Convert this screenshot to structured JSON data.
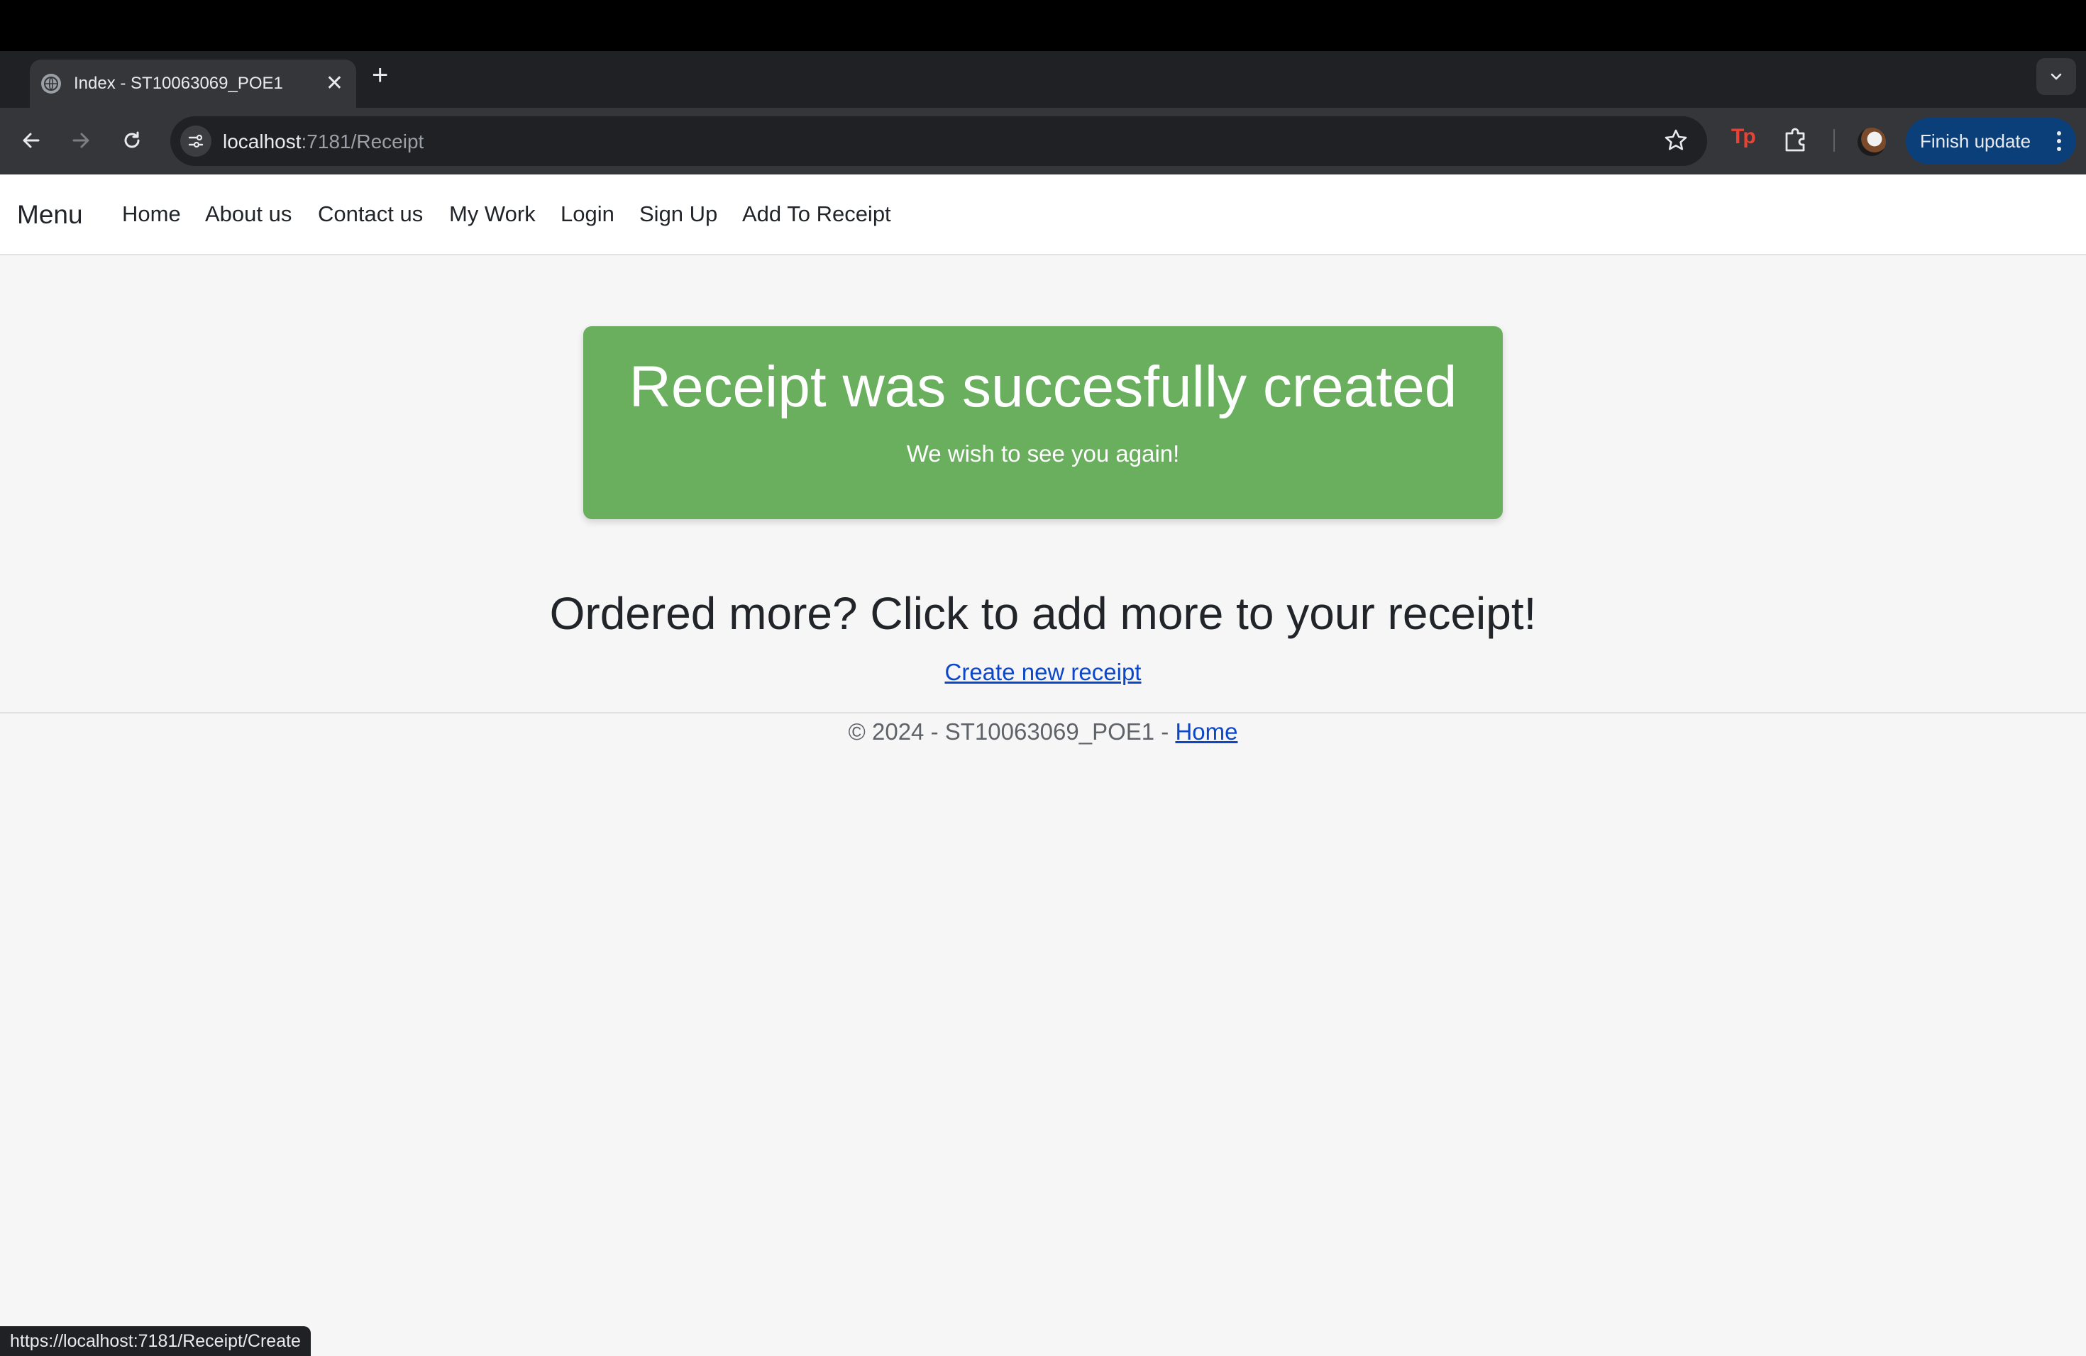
{
  "browser": {
    "tab": {
      "title": "Index - ST10063069_POE1",
      "close_glyph": "✕"
    },
    "new_tab_glyph": "+",
    "address": {
      "host": "localhost",
      "path": ":7181/Receipt"
    },
    "finish_update_label": "Finish update",
    "status_url": "https://localhost:7181/Receipt/Create",
    "extension_tp_label": "Tp"
  },
  "site_nav": {
    "brand": "Menu",
    "links": [
      "Home",
      "About us",
      "Contact us",
      "My Work",
      "Login",
      "Sign Up",
      "Add To Receipt"
    ]
  },
  "alert": {
    "title": "Receipt was succesfully created",
    "subtitle": "We wish to see you again!",
    "color": "#69af5e"
  },
  "cta": {
    "heading": "Ordered more? Click to add more to your receipt!",
    "link_label": "Create new receipt"
  },
  "footer": {
    "text": "© 2024 - ST10063069_POE1 - ",
    "home_link": "Home"
  },
  "icons": [
    "globe-icon",
    "close-icon",
    "plus-icon",
    "chevron-down-icon",
    "back-icon",
    "forward-icon",
    "reload-icon",
    "site-info-icon",
    "star-icon",
    "extension-icon",
    "puzzle-icon",
    "avatar",
    "more-vert-icon"
  ]
}
